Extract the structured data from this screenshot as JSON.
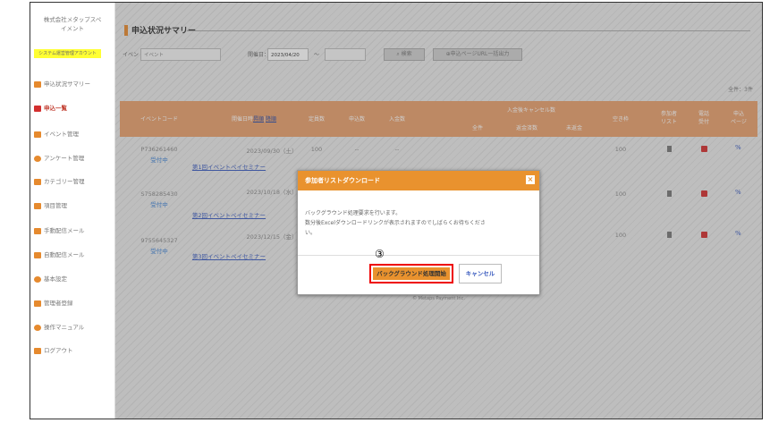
{
  "sidebar": {
    "company_line1": "株式会社メタップスペ",
    "company_line2": "イメント",
    "tag": "システム運営管理アカウント",
    "items": [
      {
        "label": "申込状況サマリー",
        "icon": "chart-icon",
        "color": "#e68a2e"
      },
      {
        "label": "申込一覧",
        "icon": "list-icon",
        "color": "#d32f2f"
      },
      {
        "label": "イベント管理",
        "icon": "grid-icon",
        "color": "#e68a2e"
      },
      {
        "label": "アンケート管理",
        "icon": "survey-icon",
        "color": "#e68a2e"
      },
      {
        "label": "カテゴリー管理",
        "icon": "category-icon",
        "color": "#e68a2e"
      },
      {
        "label": "項目管理",
        "icon": "grid-icon",
        "color": "#e68a2e"
      },
      {
        "label": "手動配信メール",
        "icon": "rss-icon",
        "color": "#e68a2e"
      },
      {
        "label": "自動配信メール",
        "icon": "mail-icon",
        "color": "#e68a2e"
      },
      {
        "label": "基本設定",
        "icon": "gear-icon",
        "color": "#e68a2e"
      },
      {
        "label": "管理者登録",
        "icon": "user-icon",
        "color": "#e68a2e"
      },
      {
        "label": "操作マニュアル",
        "icon": "help-icon",
        "color": "#e68a2e"
      },
      {
        "label": "ログアウト",
        "icon": "logout-icon",
        "color": "#e68a2e"
      }
    ]
  },
  "header": {
    "title": "申込状況サマリー"
  },
  "filters": {
    "event_label": "イベント：",
    "event_placeholder": "イベント",
    "date_label": "開催日：",
    "date_from": "2023/04/20",
    "tilde": "～",
    "search_label": "検索",
    "bulk_label": "申込ページURL一括出力"
  },
  "count": "全件：3件",
  "table": {
    "headers": {
      "event_code": "イベントコード",
      "datetime": "開催日時",
      "asc": "昇順",
      "desc": "降順",
      "capacity": "定員数",
      "applied": "申込数",
      "paid": "入金数",
      "cancel_group": "入金後キャンセル数",
      "cancel_all": "全件",
      "cancel_refunded": "返金済数",
      "cancel_unrefunded": "未返金",
      "vacancy": "空き枠",
      "participants": "参加者",
      "participants2": "リスト",
      "phone": "電話",
      "phone2": "受付",
      "apply_page": "申込",
      "apply_page2": "ページ"
    },
    "rows": [
      {
        "code": "P736261460",
        "status": "受付中",
        "date": "2023/09/30（土）",
        "event_name": "第1回イベントペイセミナー",
        "capacity": "100",
        "applied": "--",
        "paid": "--",
        "c_all": "--",
        "c_ref": "--",
        "c_unref": "--",
        "vacancy": "100"
      },
      {
        "code": "S758285430",
        "status": "受付中",
        "date": "2023/10/18（水）",
        "event_name": "第2回イベントペイセミナー",
        "capacity": "100",
        "applied": "--",
        "paid": "--",
        "c_all": "--",
        "c_ref": "--",
        "c_unref": "--",
        "vacancy": "100"
      },
      {
        "code": "9755645327",
        "status": "受付中",
        "date": "2023/12/15（金）",
        "event_name": "第3回イベントペイセミナー",
        "capacity": "100",
        "applied": "--",
        "paid": "--",
        "c_all": "--",
        "c_ref": "--",
        "c_unref": "--",
        "vacancy": "100"
      }
    ]
  },
  "footer": "© Metaps Payment Inc.",
  "modal": {
    "title": "参加者リストダウンロード",
    "close": "×",
    "line1": "バックグラウンド処理要求を行います。",
    "line2": "数分後Excelダウンロードリンクが表示されますのでしばらくお待ちくださ",
    "line3": "い。",
    "step": "③",
    "start_label": "バックグラウンド処理開始",
    "cancel_label": "キャンセル"
  }
}
